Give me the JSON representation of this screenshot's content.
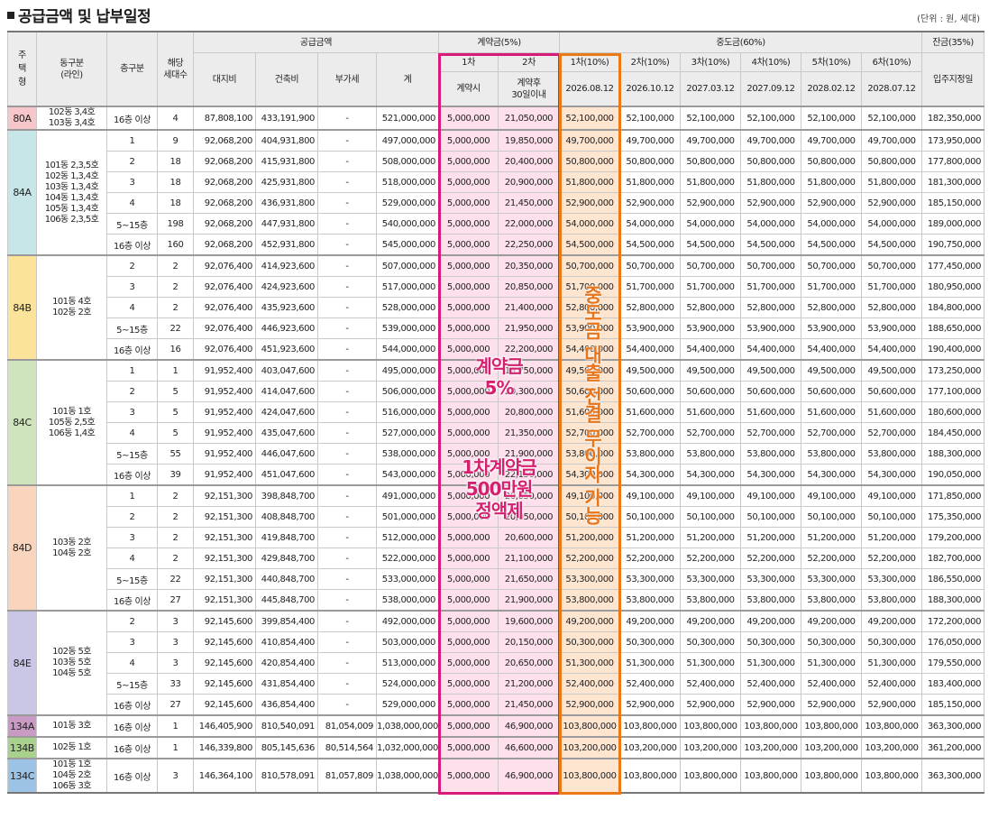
{
  "title": "공급금액 및 납부일정",
  "unit": "(단위 : 원, 세대)",
  "header": {
    "housing_type": "주택형",
    "dong_line": "동구분\n(라인)",
    "floor": "층구분",
    "units": "해당\n세대수",
    "supply_price": "공급금액",
    "land": "대지비",
    "building": "건축비",
    "vat": "부가세",
    "total": "계",
    "contract": "계약금(5%)",
    "contract_1": "1차",
    "contract_2": "2차",
    "contract_1_when": "계약시",
    "contract_2_when": "계약후\n30일이내",
    "middle": "중도금(60%)",
    "middle_labels": [
      "1차(10%)",
      "2차(10%)",
      "3차(10%)",
      "4차(10%)",
      "5차(10%)",
      "6차(10%)"
    ],
    "middle_dates": [
      "2026.08.12",
      "2026.10.12",
      "2027.03.12",
      "2027.09.12",
      "2028.02.12",
      "2028.07.12"
    ],
    "balance": "잔금(35%)",
    "balance_when": "입주지정일"
  },
  "groups": [
    {
      "type": "80A",
      "color": "#f7c6cb",
      "lines": "102동 3,4호\n103동 3,4호",
      "rows": [
        [
          "16층 이상",
          "4",
          "87,808,100",
          "433,191,900",
          "-",
          "521,000,000",
          "5,000,000",
          "21,050,000",
          "52,100,000",
          "182,350,000"
        ]
      ]
    },
    {
      "type": "84A",
      "color": "#c7e6e8",
      "lines": "101동 2,3,5호\n102동 1,3,4호\n103동 1,3,4호\n104동 1,3,4호\n105동 1,3,4호\n106동 2,3,5호",
      "rows": [
        [
          "1",
          "9",
          "92,068,200",
          "404,931,800",
          "-",
          "497,000,000",
          "5,000,000",
          "19,850,000",
          "49,700,000",
          "173,950,000"
        ],
        [
          "2",
          "18",
          "92,068,200",
          "415,931,800",
          "-",
          "508,000,000",
          "5,000,000",
          "20,400,000",
          "50,800,000",
          "177,800,000"
        ],
        [
          "3",
          "18",
          "92,068,200",
          "425,931,800",
          "-",
          "518,000,000",
          "5,000,000",
          "20,900,000",
          "51,800,000",
          "181,300,000"
        ],
        [
          "4",
          "18",
          "92,068,200",
          "436,931,800",
          "-",
          "529,000,000",
          "5,000,000",
          "21,450,000",
          "52,900,000",
          "185,150,000"
        ],
        [
          "5~15층",
          "198",
          "92,068,200",
          "447,931,800",
          "-",
          "540,000,000",
          "5,000,000",
          "22,000,000",
          "54,000,000",
          "189,000,000"
        ],
        [
          "16층 이상",
          "160",
          "92,068,200",
          "452,931,800",
          "-",
          "545,000,000",
          "5,000,000",
          "22,250,000",
          "54,500,000",
          "190,750,000"
        ]
      ]
    },
    {
      "type": "84B",
      "color": "#fbe49a",
      "lines": "101동 4호\n102동 2호",
      "rows": [
        [
          "2",
          "2",
          "92,076,400",
          "414,923,600",
          "-",
          "507,000,000",
          "5,000,000",
          "20,350,000",
          "50,700,000",
          "177,450,000"
        ],
        [
          "3",
          "2",
          "92,076,400",
          "424,923,600",
          "-",
          "517,000,000",
          "5,000,000",
          "20,850,000",
          "51,700,000",
          "180,950,000"
        ],
        [
          "4",
          "2",
          "92,076,400",
          "435,923,600",
          "-",
          "528,000,000",
          "5,000,000",
          "21,400,000",
          "52,800,000",
          "184,800,000"
        ],
        [
          "5~15층",
          "22",
          "92,076,400",
          "446,923,600",
          "-",
          "539,000,000",
          "5,000,000",
          "21,950,000",
          "53,900,000",
          "188,650,000"
        ],
        [
          "16층 이상",
          "16",
          "92,076,400",
          "451,923,600",
          "-",
          "544,000,000",
          "5,000,000",
          "22,200,000",
          "54,400,000",
          "190,400,000"
        ]
      ]
    },
    {
      "type": "84C",
      "color": "#cfe3bd",
      "lines": "101동 1호\n105동 2,5호\n106동 1,4호",
      "rows": [
        [
          "1",
          "1",
          "91,952,400",
          "403,047,600",
          "-",
          "495,000,000",
          "5,000,000",
          "19,750,000",
          "49,500,000",
          "173,250,000"
        ],
        [
          "2",
          "5",
          "91,952,400",
          "414,047,600",
          "-",
          "506,000,000",
          "5,000,000",
          "20,300,000",
          "50,600,000",
          "177,100,000"
        ],
        [
          "3",
          "5",
          "91,952,400",
          "424,047,600",
          "-",
          "516,000,000",
          "5,000,000",
          "20,800,000",
          "51,600,000",
          "180,600,000"
        ],
        [
          "4",
          "5",
          "91,952,400",
          "435,047,600",
          "-",
          "527,000,000",
          "5,000,000",
          "21,350,000",
          "52,700,000",
          "184,450,000"
        ],
        [
          "5~15층",
          "55",
          "91,952,400",
          "446,047,600",
          "-",
          "538,000,000",
          "5,000,000",
          "21,900,000",
          "53,800,000",
          "188,300,000"
        ],
        [
          "16층 이상",
          "39",
          "91,952,400",
          "451,047,600",
          "-",
          "543,000,000",
          "5,000,000",
          "22,150,000",
          "54,300,000",
          "190,050,000"
        ]
      ]
    },
    {
      "type": "84D",
      "color": "#f8d5bc",
      "lines": "103동 2호\n104동 2호",
      "rows": [
        [
          "1",
          "2",
          "92,151,300",
          "398,848,700",
          "-",
          "491,000,000",
          "5,000,000",
          "20,050,000",
          "49,100,000",
          "171,850,000"
        ],
        [
          "2",
          "2",
          "92,151,300",
          "408,848,700",
          "-",
          "501,000,000",
          "5,000,000",
          "20,050,000",
          "50,100,000",
          "175,350,000"
        ],
        [
          "3",
          "2",
          "92,151,300",
          "419,848,700",
          "-",
          "512,000,000",
          "5,000,000",
          "20,600,000",
          "51,200,000",
          "179,200,000"
        ],
        [
          "4",
          "2",
          "92,151,300",
          "429,848,700",
          "-",
          "522,000,000",
          "5,000,000",
          "21,100,000",
          "52,200,000",
          "182,700,000"
        ],
        [
          "5~15층",
          "22",
          "92,151,300",
          "440,848,700",
          "-",
          "533,000,000",
          "5,000,000",
          "21,650,000",
          "53,300,000",
          "186,550,000"
        ],
        [
          "16층 이상",
          "27",
          "92,151,300",
          "445,848,700",
          "-",
          "538,000,000",
          "5,000,000",
          "21,900,000",
          "53,800,000",
          "188,300,000"
        ]
      ]
    },
    {
      "type": "84E",
      "color": "#c9c6e6",
      "lines": "102동 5호\n103동 5호\n104동 5호",
      "rows": [
        [
          "2",
          "3",
          "92,145,600",
          "399,854,400",
          "-",
          "492,000,000",
          "5,000,000",
          "19,600,000",
          "49,200,000",
          "172,200,000"
        ],
        [
          "3",
          "3",
          "92,145,600",
          "410,854,400",
          "-",
          "503,000,000",
          "5,000,000",
          "20,150,000",
          "50,300,000",
          "176,050,000"
        ],
        [
          "4",
          "3",
          "92,145,600",
          "420,854,400",
          "-",
          "513,000,000",
          "5,000,000",
          "20,650,000",
          "51,300,000",
          "179,550,000"
        ],
        [
          "5~15층",
          "33",
          "92,145,600",
          "431,854,400",
          "-",
          "524,000,000",
          "5,000,000",
          "21,200,000",
          "52,400,000",
          "183,400,000"
        ],
        [
          "16층 이상",
          "27",
          "92,145,600",
          "436,854,400",
          "-",
          "529,000,000",
          "5,000,000",
          "21,450,000",
          "52,900,000",
          "185,150,000"
        ]
      ]
    },
    {
      "type": "134A",
      "color": "#c99bc4",
      "lines": "101동 3호",
      "rows": [
        [
          "16층 이상",
          "1",
          "146,405,900",
          "810,540,091",
          "81,054,009",
          "1,038,000,000",
          "5,000,000",
          "46,900,000",
          "103,800,000",
          "363,300,000"
        ]
      ]
    },
    {
      "type": "134B",
      "color": "#a9d18e",
      "lines": "102동 1호",
      "rows": [
        [
          "16층 이상",
          "1",
          "146,339,800",
          "805,145,636",
          "80,514,564",
          "1,032,000,000",
          "5,000,000",
          "46,600,000",
          "103,200,000",
          "361,200,000"
        ]
      ]
    },
    {
      "type": "134C",
      "color": "#9cc2e5",
      "lines": "101동 1호\n104동 2호\n106동 3호",
      "rows": [
        [
          "16층 이상",
          "3",
          "146,364,100",
          "810,578,091",
          "81,057,809",
          "1,038,000,000",
          "5,000,000",
          "46,900,000",
          "103,800,000",
          "363,300,000"
        ]
      ]
    }
  ],
  "overlay": {
    "pink_line1": "계약금",
    "pink_line2": "5%",
    "pink_line3": "1차계약금",
    "pink_line4": "500만원",
    "pink_line5": "정액제",
    "orange_text": "중도금 대출 전결 무이자 가능",
    "pink_color": "#d81b7a",
    "orange_color": "#ea7a17"
  }
}
